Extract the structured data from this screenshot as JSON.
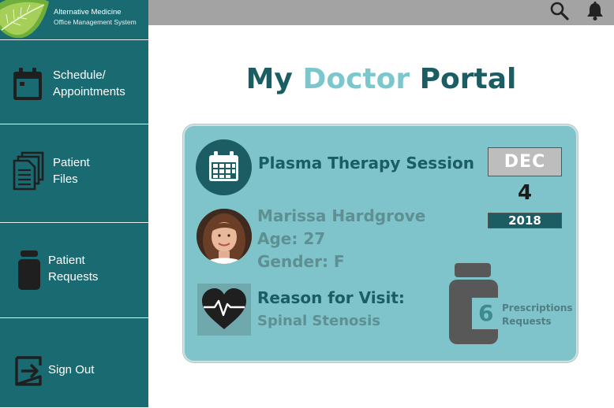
{
  "app": {
    "logo_title": "Alternative Medicine",
    "logo_subtitle": "Office Management System"
  },
  "topbar": {
    "icons": [
      "search-icon",
      "bell-icon"
    ]
  },
  "sidebar": {
    "items": [
      {
        "line1": "Schedule/",
        "line2": "Appointments",
        "icon": "calendar-icon"
      },
      {
        "line1": "Patient",
        "line2": "Files",
        "icon": "files-icon"
      },
      {
        "line1": "Patient",
        "line2": "Requests",
        "icon": "bottle-icon"
      },
      {
        "line1": "Sign Out",
        "line2": "",
        "icon": "sign-out-icon"
      }
    ]
  },
  "main": {
    "title_part1": "My",
    "title_part2": "Doctor",
    "title_part3": "Portal"
  },
  "card": {
    "session_title": "Plasma Therapy Session",
    "patient_name": "Marissa Hardgrove",
    "patient_age": "Age: 27",
    "patient_gender": "Gender: F",
    "reason_label": "Reason for Visit:",
    "reason_value": "Spinal Stenosis",
    "date_month": "DEC",
    "date_day": "4",
    "date_year": "2018",
    "prescriptions_count": "6",
    "prescriptions_label1": "Prescriptions",
    "prescriptions_label2": "Requests"
  },
  "colors": {
    "sidebar": "#1a6a72",
    "card": "#7fc4ca",
    "title_dark": "#1b5d63",
    "title_accent": "#7bc7cc",
    "topbar": "#a3a3a3"
  }
}
